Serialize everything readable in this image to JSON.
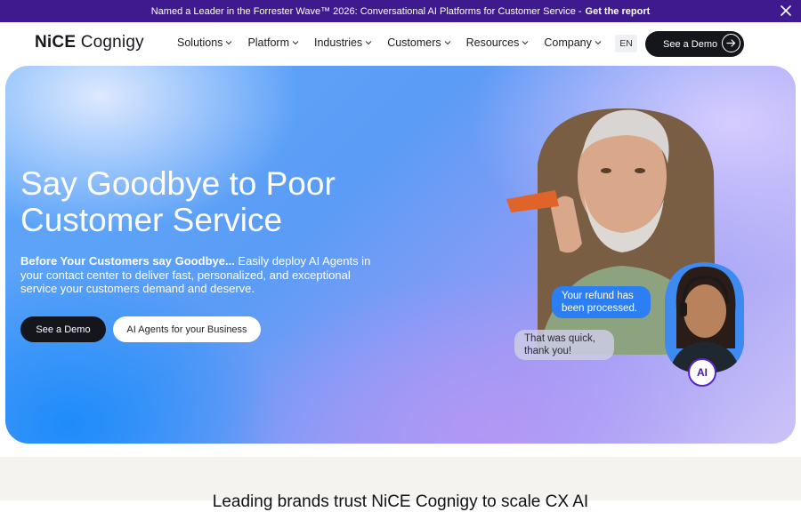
{
  "banner": {
    "text": "Named a Leader in the Forrester Wave™ 2026: Conversational AI Platforms for Customer Service -",
    "cta": "Get the report",
    "close_icon": "close-icon"
  },
  "nav": {
    "logo_part1": "NiCE",
    "logo_part2": "Cognigy",
    "items": [
      {
        "label": "Solutions"
      },
      {
        "label": "Platform"
      },
      {
        "label": "Industries"
      },
      {
        "label": "Customers"
      },
      {
        "label": "Resources"
      },
      {
        "label": "Company"
      }
    ],
    "lang": "EN",
    "demo_label": "See a Demo",
    "demo_icon": "arrow-right-icon"
  },
  "hero": {
    "title": "Say Goodbye to Poor Customer Service",
    "subtitle_bold": "Before Your Customers say Goodbye...",
    "subtitle_rest": " Easily deploy AI Agents in your contact center to deliver fast, personalized, and exceptional service your customers demand and deserve.",
    "primary_button": "See a Demo",
    "secondary_button": "AI Agents for your Business",
    "bubble_agent": "Your refund has been processed.",
    "bubble_customer": "That was quick, thank you!",
    "ai_badge": "AI"
  },
  "below": {
    "heading": "Leading brands trust NiCE Cognigy to scale CX AI"
  },
  "colors": {
    "banner_bg": "#3e1a8e",
    "dark_button": "#14161b",
    "bubble_blue": "#2c7ff2"
  }
}
